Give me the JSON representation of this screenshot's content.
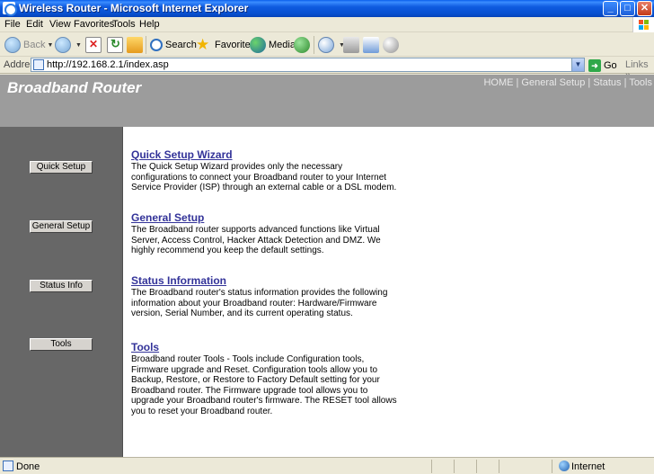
{
  "window": {
    "title": "Wireless Router - Microsoft Internet Explorer",
    "minimize": "_",
    "maximize": "□",
    "close": "✕"
  },
  "menu": {
    "items": [
      "File",
      "Edit",
      "View",
      "Favorites",
      "Tools",
      "Help"
    ]
  },
  "toolbar": {
    "back": "Back",
    "search": "Search",
    "favorites": "Favorites",
    "media": "Media"
  },
  "address": {
    "label": "Address",
    "url": "http://192.168.2.1/index.asp",
    "go": "Go",
    "links": "Links »"
  },
  "page": {
    "brand": "Broadband Router",
    "topnav": {
      "home": "HOME",
      "general": "General Setup",
      "status": "Status",
      "tools": "Tools",
      "separator": "|"
    },
    "sidebar": {
      "quick": "Quick Setup",
      "general": "General Setup",
      "status": "Status Info",
      "tools": "Tools"
    },
    "sections": [
      {
        "title": "Quick Setup Wizard",
        "desc": "The Quick Setup Wizard provides only the necessary configurations to connect your Broadband router to your Internet Service Provider (ISP) through an external cable or a DSL modem."
      },
      {
        "title": "General Setup",
        "desc": "The Broadband router supports advanced functions like Virtual Server, Access Control, Hacker Attack Detection and DMZ. We highly recommend you keep the default settings."
      },
      {
        "title": "Status Information",
        "desc": "The Broadband router's status information provides the following information about your Broadband router: Hardware/Firmware version, Serial Number, and its current operating status."
      },
      {
        "title": "Tools",
        "desc": "Broadband router Tools - Tools include Configuration tools, Firmware upgrade and Reset. Configuration tools allow you to Backup, Restore, or Restore to Factory Default setting for your Broadband router. The Firmware upgrade tool allows you to upgrade your Broadband router's firmware. The RESET tool allows you to reset your Broadband router."
      }
    ]
  },
  "status": {
    "text": "Done",
    "zone": "Internet"
  }
}
